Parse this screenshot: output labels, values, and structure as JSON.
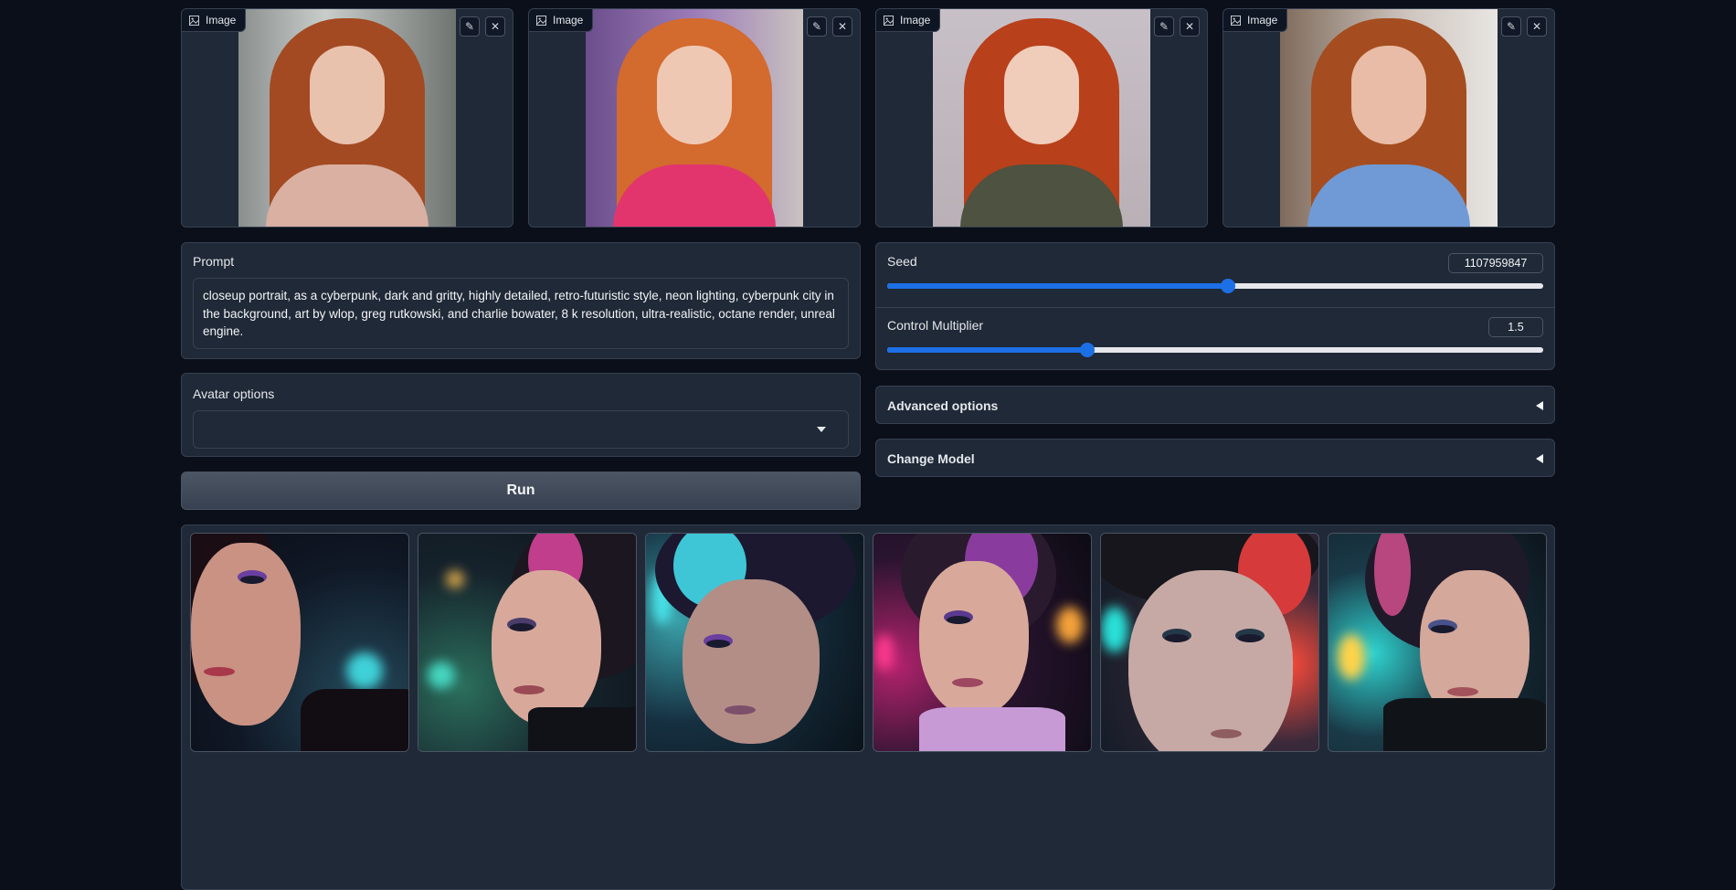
{
  "image_inputs": [
    {
      "label": "Image"
    },
    {
      "label": "Image"
    },
    {
      "label": "Image"
    },
    {
      "label": "Image"
    }
  ],
  "prompt": {
    "label": "Prompt",
    "value": "closeup portrait, as a cyberpunk, dark and gritty, highly detailed, retro-futuristic style, neon lighting, cyberpunk city in the background, art by wlop, greg rutkowski, and charlie bowater, 8 k resolution, ultra-realistic, octane render, unreal engine."
  },
  "avatar_options": {
    "label": "Avatar options",
    "selected": ""
  },
  "run_button": {
    "label": "Run"
  },
  "seed": {
    "label": "Seed",
    "value": "1107959847",
    "fraction": 0.519
  },
  "control_multiplier": {
    "label": "Control Multiplier",
    "value": "1.5",
    "fraction": 0.305
  },
  "accordions": {
    "advanced": {
      "label": "Advanced options"
    },
    "change_model": {
      "label": "Change Model"
    }
  },
  "icons": {
    "image": "image-icon",
    "edit": "pencil-icon",
    "clear": "close-icon",
    "dropdown": "chevron-down-icon",
    "accordion": "triangle-left-icon"
  },
  "colors": {
    "background": "#0b0f19",
    "panel": "#1f2937",
    "border": "#374151",
    "slider_accent": "#1d6fe6"
  },
  "gallery_count": 6
}
